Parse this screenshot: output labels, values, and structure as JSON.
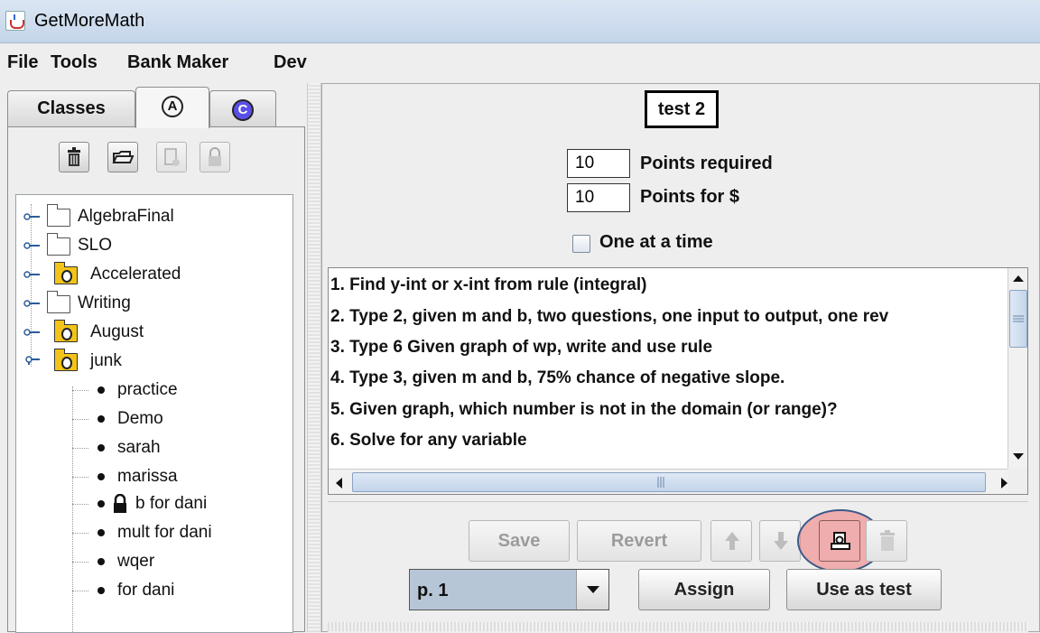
{
  "window": {
    "title": "GetMoreMath"
  },
  "menu": {
    "items": [
      "File",
      "Tools",
      "Bank Maker",
      "Dev"
    ]
  },
  "left_tabs": {
    "classes": "Classes",
    "a_letter": "A",
    "c_letter": "C"
  },
  "tree": {
    "folders": [
      {
        "label": "AlgebraFinal",
        "type": "folder"
      },
      {
        "label": "SLO",
        "type": "folder"
      },
      {
        "label": "Accelerated",
        "type": "class"
      },
      {
        "label": "Writing",
        "type": "folder"
      },
      {
        "label": "August",
        "type": "class"
      },
      {
        "label": "junk",
        "type": "class"
      }
    ],
    "children": [
      "practice",
      "Demo",
      "sarah",
      "marissa",
      "b for dani",
      "mult for dani",
      "wqer",
      "for dani"
    ]
  },
  "test": {
    "title": "test 2",
    "points_required_value": "10",
    "points_required_label": "Points required",
    "points_for_dollar_value": "10",
    "points_for_dollar_label": "Points for $",
    "one_at_a_time_label": "One at a time"
  },
  "questions": [
    "1. Find y-int or x-int from rule (integral)",
    "2. Type 2, given m and b, two questions, one input to output, one rev",
    "3. Type 6 Given graph of wp, write and use rule",
    "4. Type 3, given m and b, 75% chance of negative slope.",
    "5. Given graph, which number is not in the domain (or range)?",
    "6. Solve for any variable"
  ],
  "actions": {
    "save": "Save",
    "revert": "Revert",
    "page_select": "p. 1",
    "assign": "Assign",
    "use_as_test": "Use as test"
  },
  "colors": {
    "highlight": "#f07878",
    "accent": "#5a4fe6",
    "selected_row": "#b7c6d6"
  }
}
